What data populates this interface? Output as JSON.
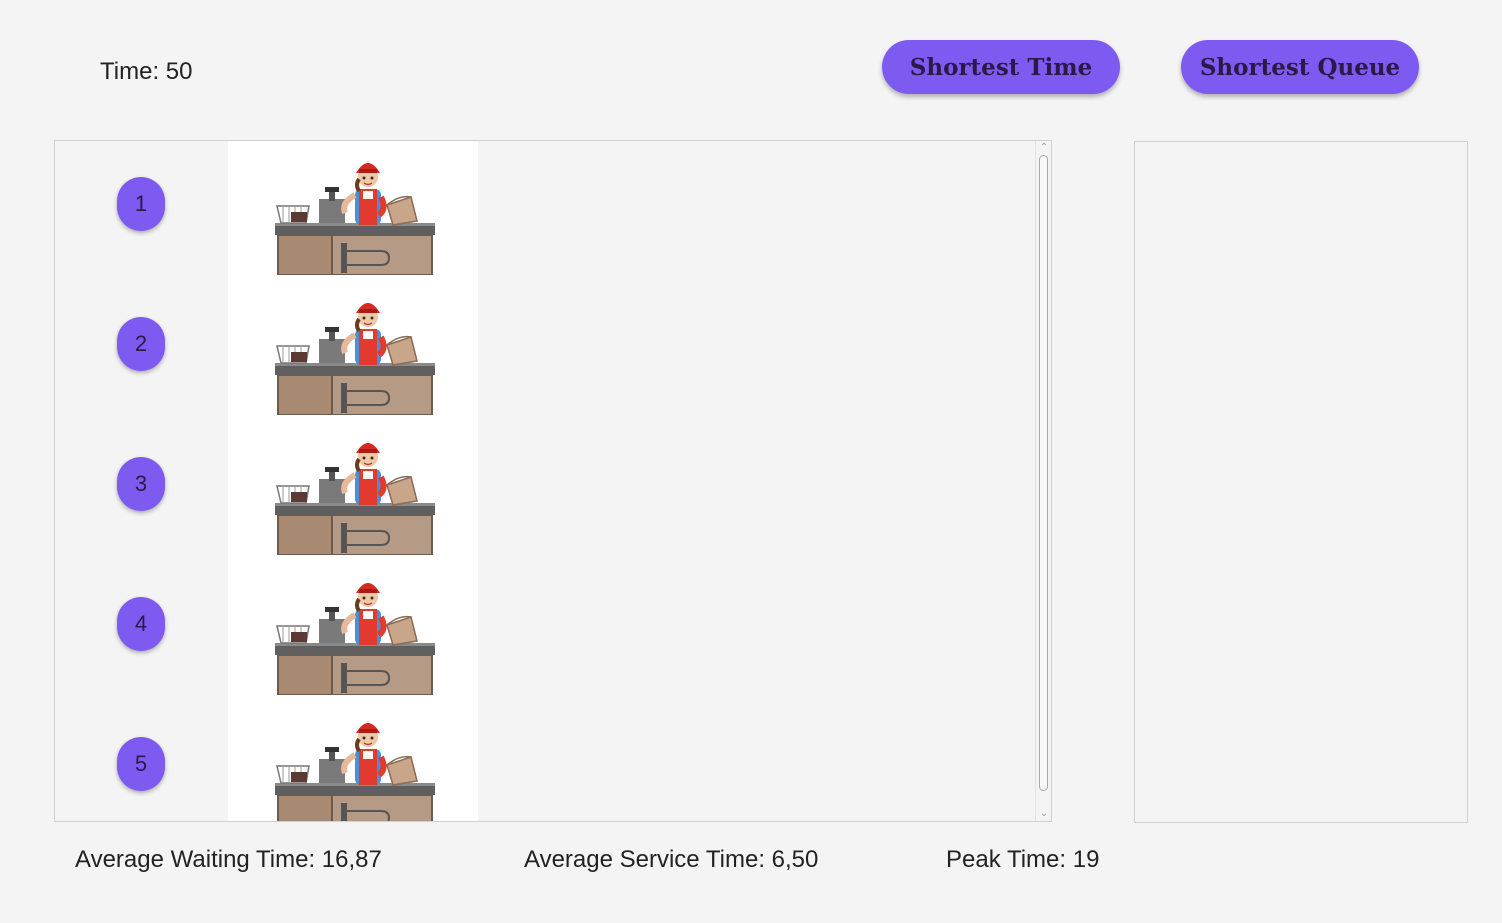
{
  "header": {
    "time_label": "Time: 50",
    "shortest_time_button": "Shortest Time",
    "shortest_queue_button": "Shortest Queue"
  },
  "queues": [
    {
      "number": "1"
    },
    {
      "number": "2"
    },
    {
      "number": "3"
    },
    {
      "number": "4"
    },
    {
      "number": "5"
    }
  ],
  "stats": {
    "average_waiting": "Average Waiting Time: 16,87",
    "average_service": "Average Service Time: 6,50",
    "peak_time": "Peak Time: 19"
  },
  "colors": {
    "accent": "#7e5bf0",
    "background": "#f4f4f4"
  },
  "icons": {
    "cashier": "cashier-at-register-icon"
  }
}
